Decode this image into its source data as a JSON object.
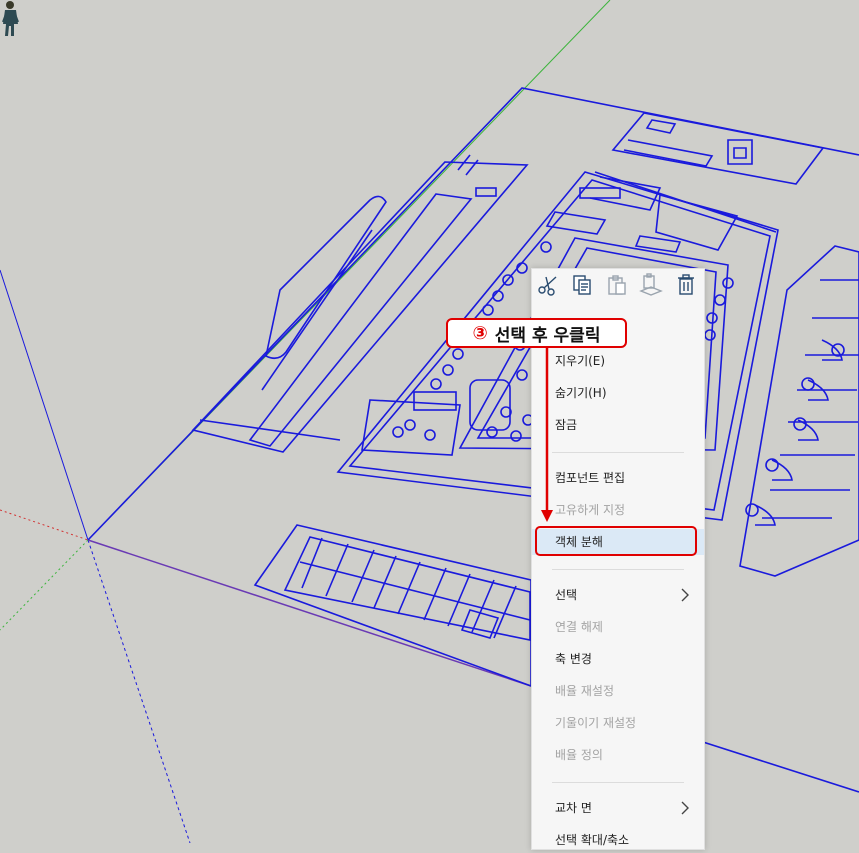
{
  "canvas": {
    "background": "#cfcfcb",
    "line_color": "#1a1adc",
    "green_axis": "#3cb43c",
    "red_axis": "#d23232",
    "purple_edge": "#6a3ab4"
  },
  "toolbar_icons": [
    "scissors-icon",
    "copy-icon",
    "paste-icon",
    "paste-in-place-icon",
    "trash-icon"
  ],
  "menu": {
    "items": [
      {
        "label": "지우기(E)"
      },
      {
        "label": "숨기기(H)"
      },
      {
        "label": "잠금"
      },
      {
        "label": "컴포넌트 편집"
      },
      {
        "label": "고유하게 지정",
        "disabled": true
      },
      {
        "label": "객체 분해",
        "highlighted": true
      },
      {
        "label": "선택",
        "submenu": true
      },
      {
        "label": "연결 해제",
        "disabled": true
      },
      {
        "label": "축 변경"
      },
      {
        "label": "배율 재설정",
        "disabled": true
      },
      {
        "label": "기울이기 재설정",
        "disabled": true
      },
      {
        "label": "배율 정의",
        "disabled": true
      },
      {
        "label": "교차 면",
        "submenu": true
      },
      {
        "label": "선택 확대/축소"
      }
    ]
  },
  "annotation": {
    "step": "③",
    "text": "선택 후 우클릭",
    "color": "#e00000"
  }
}
